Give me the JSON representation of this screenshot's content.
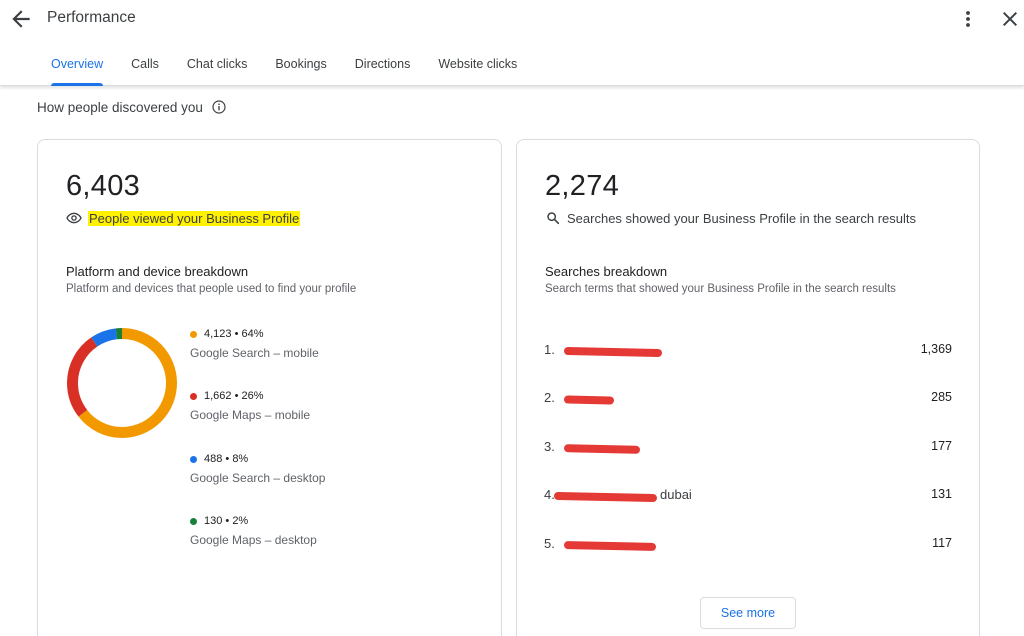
{
  "header": {
    "title": "Performance"
  },
  "tabs": [
    {
      "label": "Overview",
      "active": true
    },
    {
      "label": "Calls"
    },
    {
      "label": "Chat clicks"
    },
    {
      "label": "Bookings"
    },
    {
      "label": "Directions"
    },
    {
      "label": "Website clicks"
    }
  ],
  "section": {
    "title": "How people discovered you"
  },
  "views_card": {
    "total": "6,403",
    "caption": "People viewed your Business Profile",
    "breakdown_title": "Platform and device breakdown",
    "breakdown_desc": "Platform and devices that people used to find your profile",
    "items": [
      {
        "value": "4,123 • 64%",
        "label": "Google Search – mobile",
        "color": "#f29900",
        "fraction": 0.644
      },
      {
        "value": "1,662 • 26%",
        "label": "Google Maps – mobile",
        "color": "#d93025",
        "fraction": 0.26
      },
      {
        "value": "488 • 8%",
        "label": "Google Search – desktop",
        "color": "#1a73e8",
        "fraction": 0.076
      },
      {
        "value": "130 • 2%",
        "label": "Google Maps – desktop",
        "color": "#188038",
        "fraction": 0.02
      }
    ]
  },
  "searches_card": {
    "total": "2,274",
    "caption": "Searches showed your Business Profile in the search results",
    "breakdown_title": "Searches breakdown",
    "breakdown_desc": "Search terms that showed your Business Profile in the search results",
    "terms": [
      {
        "rank": "1.",
        "term": "",
        "count": "1,369"
      },
      {
        "rank": "2.",
        "term": "",
        "count": "285"
      },
      {
        "rank": "3.",
        "term": "",
        "count": "177"
      },
      {
        "rank": "4.",
        "term": "dubai",
        "count": "131"
      },
      {
        "rank": "5.",
        "term": "",
        "count": "117"
      }
    ],
    "see_more": "See more"
  }
}
